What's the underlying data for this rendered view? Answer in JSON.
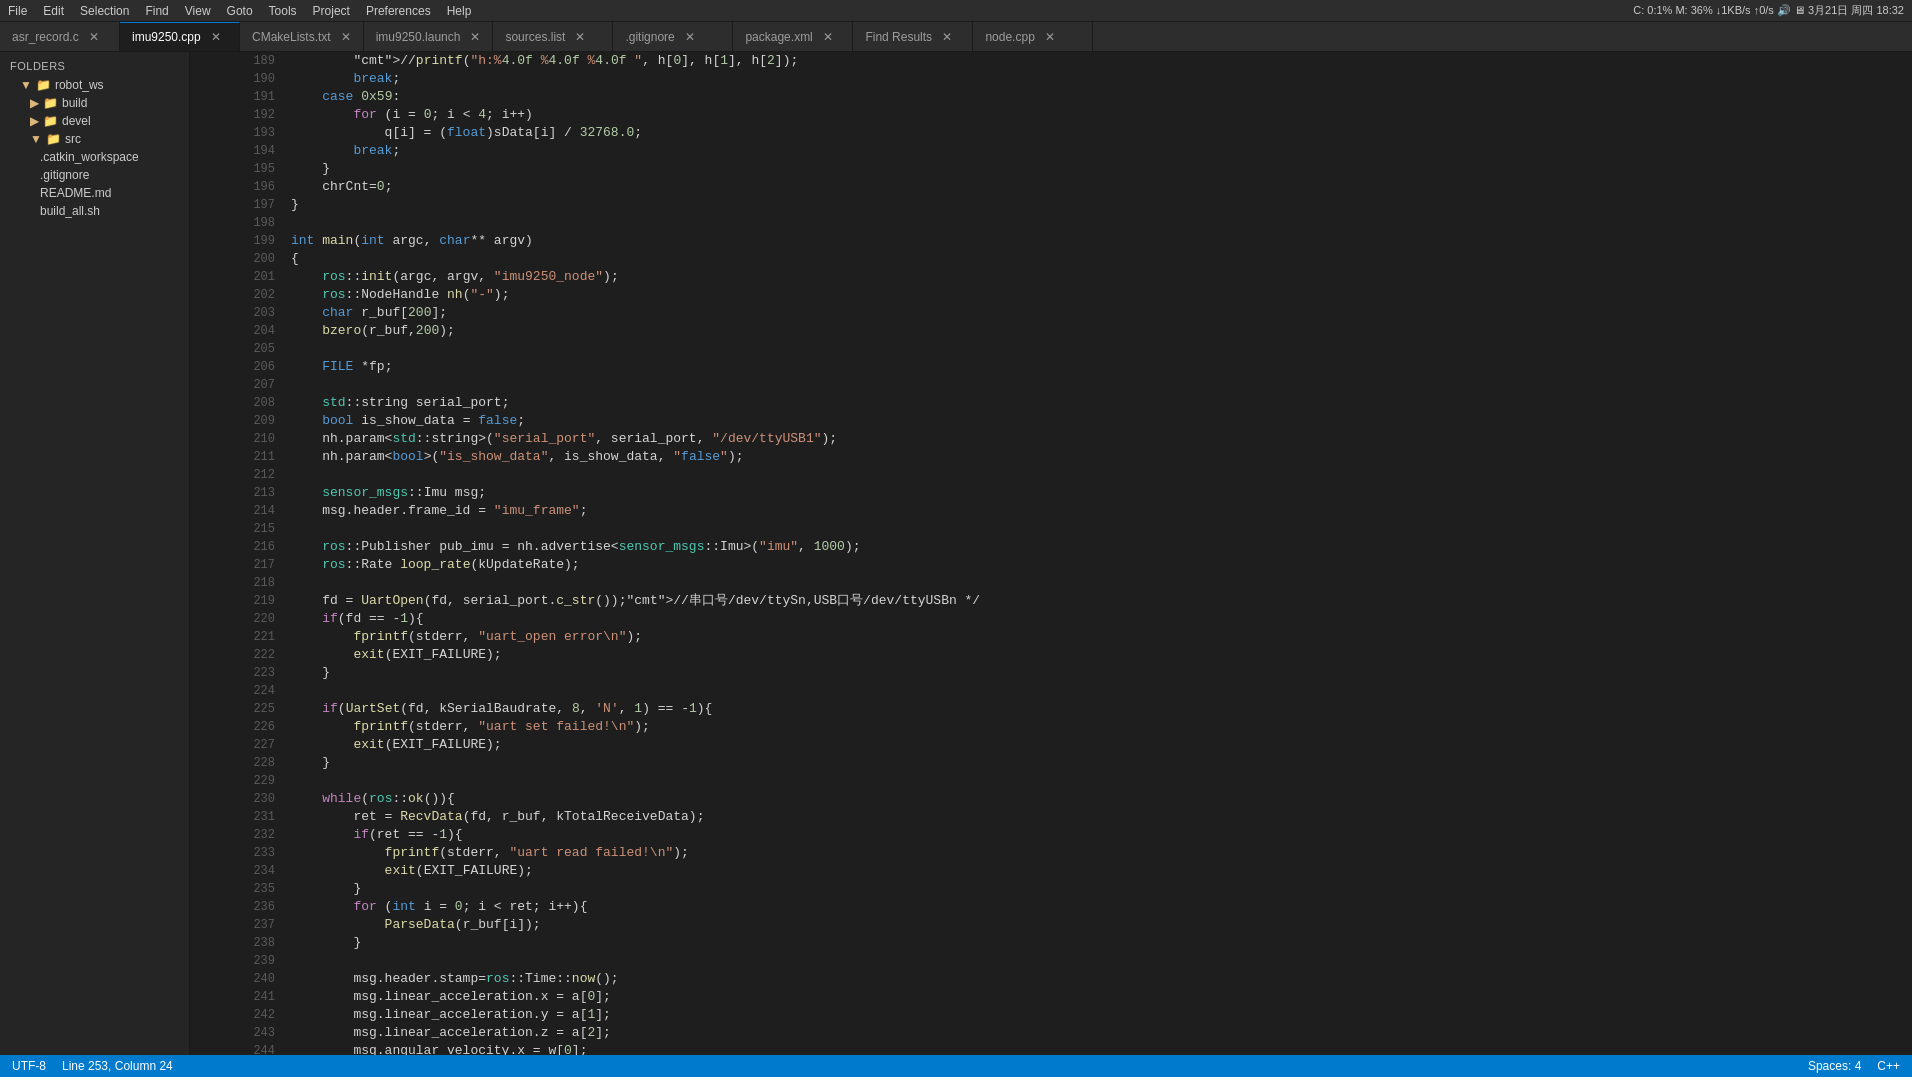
{
  "menubar": {
    "items": [
      "File",
      "Edit",
      "Selection",
      "Find",
      "View",
      "Goto",
      "Tools",
      "Project",
      "Preferences",
      "Help"
    ],
    "status": "C: 0:1% M: 36% ↓1KB/s ↑0/s 🔊 🖥 3月21日 周四 18:32"
  },
  "tabs": [
    {
      "label": "asr_record.c",
      "active": false,
      "closable": true
    },
    {
      "label": "imu9250.cpp",
      "active": true,
      "closable": true
    },
    {
      "label": "CMakeLists.txt",
      "active": false,
      "closable": true
    },
    {
      "label": "imu9250.launch",
      "active": false,
      "closable": true
    },
    {
      "label": "sources.list",
      "active": false,
      "closable": true
    },
    {
      "label": ".gitignore",
      "active": false,
      "closable": true
    },
    {
      "label": "package.xml",
      "active": false,
      "closable": true
    },
    {
      "label": "Find Results",
      "active": false,
      "closable": true
    },
    {
      "label": "node.cpp",
      "active": false,
      "closable": true
    }
  ],
  "sidebar": {
    "title": "FOLDERS",
    "items": [
      {
        "label": "robot_ws",
        "type": "folder",
        "indent": 0,
        "open": true
      },
      {
        "label": "build",
        "type": "folder",
        "indent": 1,
        "open": false
      },
      {
        "label": "devel",
        "type": "folder",
        "indent": 1,
        "open": false
      },
      {
        "label": "src",
        "type": "folder",
        "indent": 1,
        "open": true
      },
      {
        "label": ".catkin_workspace",
        "type": "file",
        "indent": 2
      },
      {
        "label": ".gitignore",
        "type": "file",
        "indent": 2
      },
      {
        "label": "README.md",
        "type": "file",
        "indent": 2
      },
      {
        "label": "build_all.sh",
        "type": "file",
        "indent": 2
      }
    ]
  },
  "statusbar": {
    "left": [
      "UTF-8",
      "Line 253, Column 24"
    ],
    "right": [
      "Spaces: 4",
      "C++"
    ]
  },
  "code": {
    "lines": [
      {
        "num": 189,
        "content": "        //printf(\"h:%4.0f %4.0f %4.0f \", h[0], h[1], h[2]);"
      },
      {
        "num": 190,
        "content": "        break;"
      },
      {
        "num": 191,
        "content": "    case 0x59:"
      },
      {
        "num": 192,
        "content": "        for (i = 0; i < 4; i++)"
      },
      {
        "num": 193,
        "content": "            q[i] = (float)sData[i] / 32768.0;"
      },
      {
        "num": 194,
        "content": "        break;"
      },
      {
        "num": 195,
        "content": "    }"
      },
      {
        "num": 196,
        "content": "    chrCnt=0;"
      },
      {
        "num": 197,
        "content": "}"
      },
      {
        "num": 198,
        "content": ""
      },
      {
        "num": 199,
        "content": "int main(int argc, char** argv)"
      },
      {
        "num": 200,
        "content": "{"
      },
      {
        "num": 201,
        "content": "    ros::init(argc, argv, \"imu9250_node\");"
      },
      {
        "num": 202,
        "content": "    ros::NodeHandle nh(\"-\");"
      },
      {
        "num": 203,
        "content": "    char r_buf[200];"
      },
      {
        "num": 204,
        "content": "    bzero(r_buf,200);"
      },
      {
        "num": 205,
        "content": ""
      },
      {
        "num": 206,
        "content": "    FILE *fp;"
      },
      {
        "num": 207,
        "content": ""
      },
      {
        "num": 208,
        "content": "    std::string serial_port;"
      },
      {
        "num": 209,
        "content": "    bool is_show_data = false;"
      },
      {
        "num": 210,
        "content": "    nh.param<std::string>(\"serial_port\", serial_port, \"/dev/ttyUSB1\");"
      },
      {
        "num": 211,
        "content": "    nh.param<bool>(\"is_show_data\", is_show_data, \"false\");"
      },
      {
        "num": 212,
        "content": ""
      },
      {
        "num": 213,
        "content": "    sensor_msgs::Imu msg;"
      },
      {
        "num": 214,
        "content": "    msg.header.frame_id = \"imu_frame\";"
      },
      {
        "num": 215,
        "content": ""
      },
      {
        "num": 216,
        "content": "    ros::Publisher pub_imu = nh.advertise<sensor_msgs::Imu>(\"imu\", 1000);"
      },
      {
        "num": 217,
        "content": "    ros::Rate loop_rate(kUpdateRate);"
      },
      {
        "num": 218,
        "content": ""
      },
      {
        "num": 219,
        "content": "    fd = UartOpen(fd, serial_port.c_str());//串口号/dev/ttySn,USB口号/dev/ttyUSBn */"
      },
      {
        "num": 220,
        "content": "    if(fd == -1){"
      },
      {
        "num": 221,
        "content": "        fprintf(stderr, \"uart_open error\\n\");"
      },
      {
        "num": 222,
        "content": "        exit(EXIT_FAILURE);"
      },
      {
        "num": 223,
        "content": "    }"
      },
      {
        "num": 224,
        "content": ""
      },
      {
        "num": 225,
        "content": "    if(UartSet(fd, kSerialBaudrate, 8, 'N', 1) == -1){"
      },
      {
        "num": 226,
        "content": "        fprintf(stderr, \"uart set failed!\\n\");"
      },
      {
        "num": 227,
        "content": "        exit(EXIT_FAILURE);"
      },
      {
        "num": 228,
        "content": "    }"
      },
      {
        "num": 229,
        "content": ""
      },
      {
        "num": 230,
        "content": "    while(ros::ok()){"
      },
      {
        "num": 231,
        "content": "        ret = RecvData(fd, r_buf, kTotalReceiveData);"
      },
      {
        "num": 232,
        "content": "        if(ret == -1){"
      },
      {
        "num": 233,
        "content": "            fprintf(stderr, \"uart read failed!\\n\");"
      },
      {
        "num": 234,
        "content": "            exit(EXIT_FAILURE);"
      },
      {
        "num": 235,
        "content": "        }"
      },
      {
        "num": 236,
        "content": "        for (int i = 0; i < ret; i++){"
      },
      {
        "num": 237,
        "content": "            ParseData(r_buf[i]);"
      },
      {
        "num": 238,
        "content": "        }"
      },
      {
        "num": 239,
        "content": ""
      },
      {
        "num": 240,
        "content": "        msg.header.stamp=ros::Time::now();"
      },
      {
        "num": 241,
        "content": "        msg.linear_acceleration.x = a[0];"
      },
      {
        "num": 242,
        "content": "        msg.linear_acceleration.y = a[1];"
      },
      {
        "num": 243,
        "content": "        msg.linear_acceleration.z = a[2];"
      },
      {
        "num": 244,
        "content": "        msg.angular_velocity.x = w[0];"
      }
    ]
  }
}
